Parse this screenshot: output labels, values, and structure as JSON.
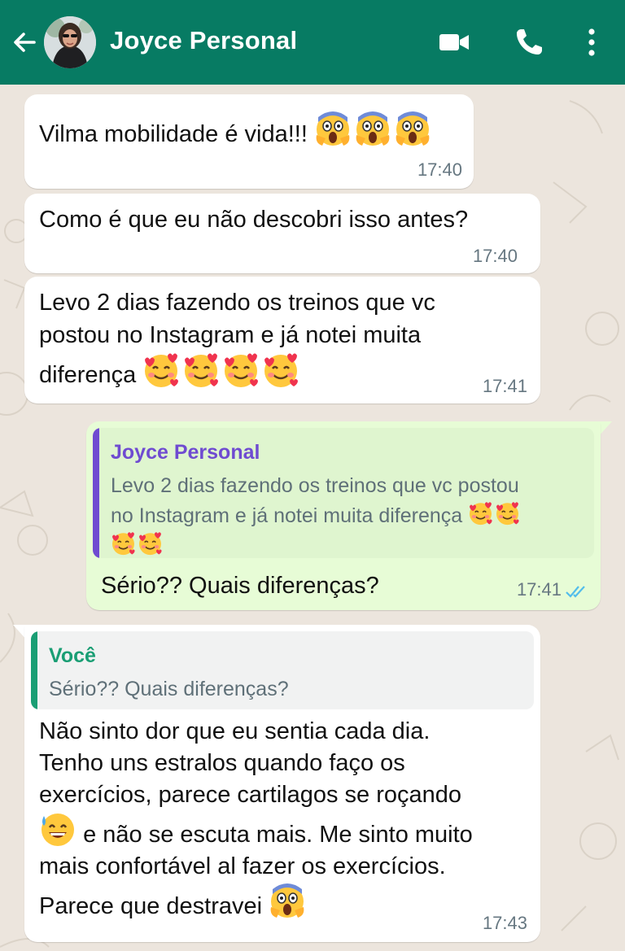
{
  "header": {
    "contact_name": "Joyce Personal",
    "back_icon": "arrow-left-icon",
    "video_icon": "video-camera-icon",
    "call_icon": "phone-icon",
    "menu_icon": "vertical-dots-icon",
    "color": "#077b63"
  },
  "colors": {
    "incoming_bubble": "#ffffff",
    "outgoing_bubble": "#e7fcd6",
    "chat_background": "#ece5dd",
    "read_ticks": "#53bdeb",
    "quote_name_contact": "#6f4bd1",
    "quote_name_self": "#1a9e74"
  },
  "messages": [
    {
      "direction": "incoming",
      "text": "Vilma mobilidade é vida!!!",
      "emoji": "screaming-face-emoji ×3",
      "time": "17:40"
    },
    {
      "direction": "incoming",
      "text": "Como é que eu não descobri isso antes?",
      "time": "17:40"
    },
    {
      "direction": "incoming",
      "lines": [
        "Levo 2 dias fazendo os treinos que vc",
        "postou no Instagram e já notei muita",
        "diferença"
      ],
      "emoji": "smiling-face-with-hearts-emoji ×4",
      "time": "17:41"
    },
    {
      "direction": "outgoing",
      "quote": {
        "author": "Joyce Personal",
        "lines": [
          "Levo 2 dias fazendo os treinos que vc postou",
          "no Instagram e já notei muita diferença"
        ],
        "emoji": "smiling-face-with-hearts-emoji ×4"
      },
      "text": "Sério?? Quais diferenças?",
      "time": "17:41",
      "status_icon": "double-check-read-icon"
    },
    {
      "direction": "incoming",
      "quote": {
        "author": "Você",
        "text": "Sério?? Quais diferenças?"
      },
      "lines": [
        "Não sinto dor que eu sentia cada dia.",
        "Tenho uns estralos quando faço os",
        "exercícios, parece cartilagos se roçando",
        "e não se escuta mais. Me sinto muito",
        "mais confortável al fazer os exercícios.",
        "Parece que destravei"
      ],
      "emoji": "grinning-face-with-sweat-emoji, screaming-face-emoji",
      "time": "17:43"
    }
  ]
}
